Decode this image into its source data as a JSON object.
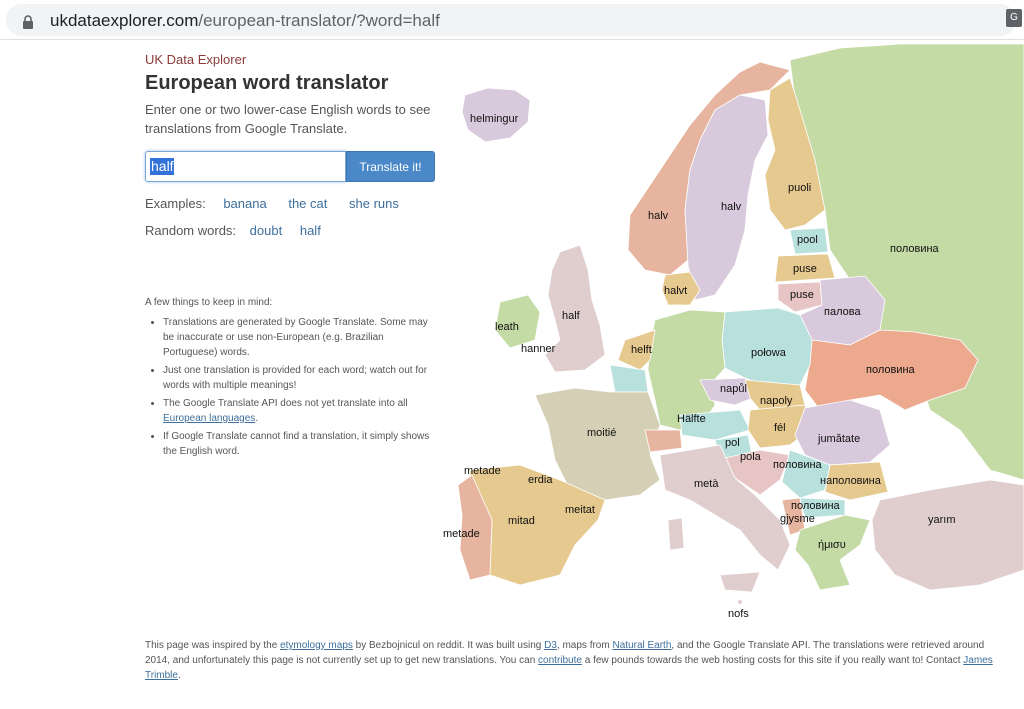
{
  "browser": {
    "url_domain": "ukdataexplorer.com",
    "url_path": "/european-translator/?word=half"
  },
  "header": {
    "site_name": "UK Data Explorer",
    "title": "European word translator",
    "intro": "Enter one or two lower-case English words to see translations from Google Translate."
  },
  "search": {
    "value": "half",
    "button_label": "Translate it!"
  },
  "examples": {
    "label": "Examples:",
    "items": [
      "banana",
      "the cat",
      "she runs"
    ]
  },
  "random": {
    "label": "Random words:",
    "items": [
      "doubt",
      "half"
    ]
  },
  "notes": {
    "title": "A few things to keep in mind:",
    "item1": "Translations are generated by Google Translate. Some may be inaccurate or use non-European (e.g. Brazilian Portuguese) words.",
    "item2": "Just one translation is provided for each word; watch out for words with multiple meanings!",
    "item3_text": "The Google Translate API does not yet translate into all",
    "item3_link": "European languages",
    "item4": "If Google Translate cannot find a translation, it simply shows the English word."
  },
  "map_labels": {
    "iceland": "helmingur",
    "norway": "halv",
    "sweden": "halv",
    "finland": "puoli",
    "russia": "половина",
    "estonia": "pool",
    "latvia": "puse",
    "lithuania": "puse",
    "belarus": "палова",
    "denmark": "halvt",
    "ireland": "leath",
    "uk": "half",
    "isle_of_man": "hanner",
    "netherlands": "helft",
    "poland": "połowa",
    "ukraine": "половина",
    "czechia": "napůl",
    "slovakia": "napoly",
    "germany": "Hälfte",
    "hungary": "fél",
    "france": "moitié",
    "romania": "jumătate",
    "slovenia": "pol",
    "croatia": "pola",
    "serbia": "половина",
    "bulgaria": "наполовина",
    "italy": "metà",
    "spain_basque": "erdia",
    "spain_galicia": "metade",
    "spain": "mitad",
    "catalonia": "meitat",
    "portugal": "metade",
    "macedonia": "половина",
    "albania": "gjysme",
    "greece": "ήμισυ",
    "turkey": "yarım",
    "malta": "nofs"
  },
  "footer": {
    "t1": "This page was inspired by the ",
    "l1": "etymology maps",
    "t2": " by Bezbojnicul on reddit. It was built using ",
    "l2": "D3",
    "t3": ", maps from ",
    "l3": "Natural Earth",
    "t4": ", and the Google Translate API. The translations were retrieved around 2014, and unfortunately this page is not currently set up to get new translations. You can ",
    "l4": "contribute",
    "t5": " a few pounds towards the web hosting costs for this site if you really want to! Contact ",
    "l5": "James Trimble",
    "t6": "."
  }
}
